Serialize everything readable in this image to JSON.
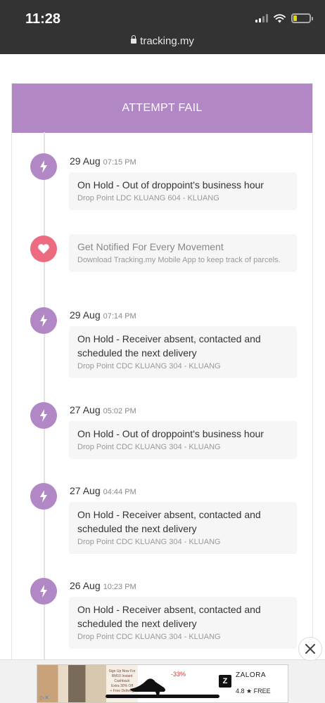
{
  "status_bar": {
    "time": "11:28"
  },
  "browser": {
    "url": "tracking.my"
  },
  "header": {
    "title": "ATTEMPT FAIL"
  },
  "colors": {
    "accent": "#b187c5",
    "promo": "#ec6b80",
    "status_bar": "#333333"
  },
  "events": [
    {
      "date": "29 Aug",
      "time": "07:15 PM",
      "title": "On Hold - Out of droppoint's business hour",
      "location": "Drop Point LDC KLUANG 604 - KLUANG",
      "icon": "bolt-icon"
    },
    {
      "date": "29 Aug",
      "time": "07:14 PM",
      "title": "On Hold - Receiver absent, contacted and scheduled the next delivery",
      "location": "Drop Point CDC KLUANG 304 - KLUANG",
      "icon": "bolt-icon"
    },
    {
      "date": "27 Aug",
      "time": "05:02 PM",
      "title": "On Hold - Out of droppoint's business hour",
      "location": "Drop Point CDC KLUANG 304 - KLUANG",
      "icon": "bolt-icon"
    },
    {
      "date": "27 Aug",
      "time": "04:44 PM",
      "title": "On Hold - Receiver absent, contacted and scheduled the next delivery",
      "location": "Drop Point CDC KLUANG 304 - KLUANG",
      "icon": "bolt-icon"
    },
    {
      "date": "26 Aug",
      "time": "10:23 PM",
      "title": "On Hold - Receiver absent, contacted and scheduled the next delivery",
      "location": "Drop Point CDC KLUANG 304 - KLUANG",
      "icon": "bolt-icon"
    }
  ],
  "promo": {
    "title": "Get Notified For Every Movement",
    "text": "Download Tracking.my Mobile App to keep track of parcels.",
    "icon": "heart-icon"
  },
  "ad": {
    "brand": "ZALORA",
    "rating": "4.8 ★ FREE",
    "discount": "-33%",
    "logo_letter": "Z",
    "promo_lines": [
      "Sign Up Now For",
      "RM10 Instant",
      "Cashback",
      "Extra 30% Off",
      "+ Free Delivery"
    ]
  }
}
